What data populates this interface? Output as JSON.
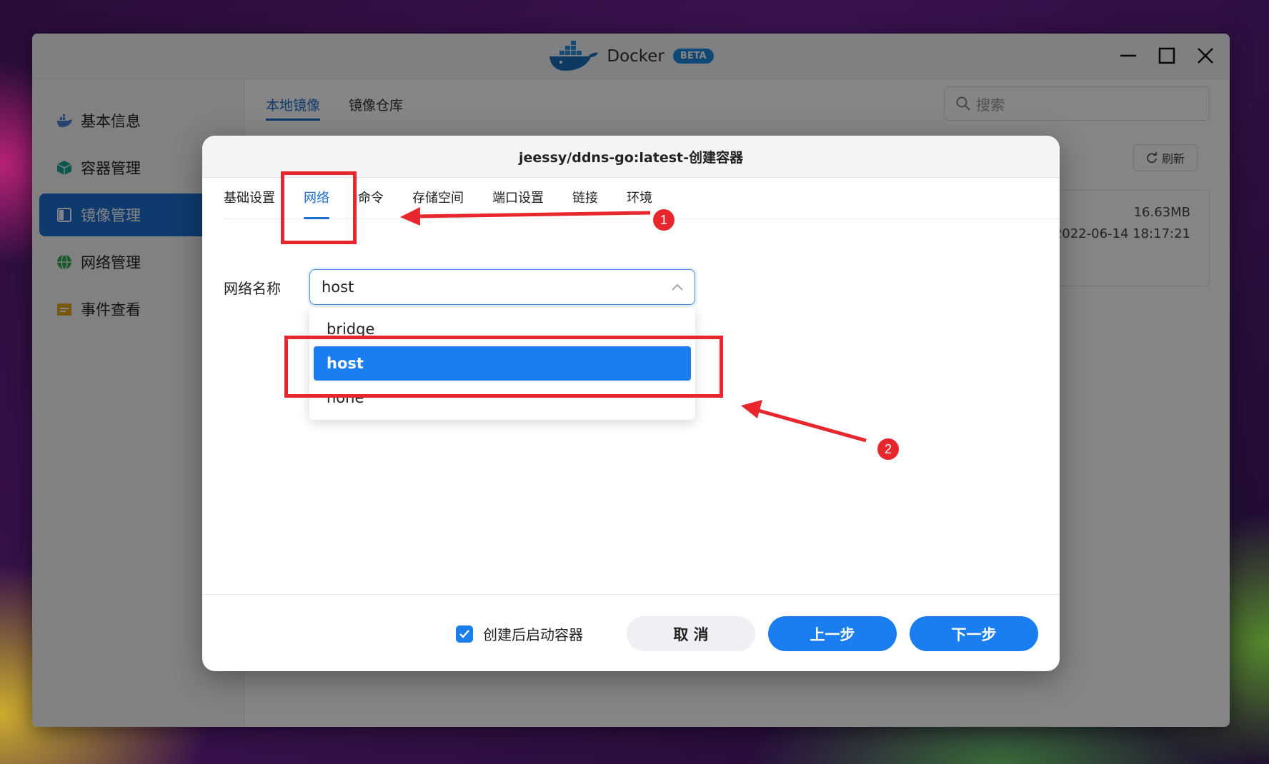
{
  "window": {
    "app_title": "Docker",
    "beta_badge": "BETA"
  },
  "sidebar": {
    "items": [
      {
        "label": "基本信息",
        "icon": "docker-whale-icon"
      },
      {
        "label": "容器管理",
        "icon": "cube-icon"
      },
      {
        "label": "镜像管理",
        "icon": "image-icon",
        "active": true
      },
      {
        "label": "网络管理",
        "icon": "globe-icon"
      },
      {
        "label": "事件查看",
        "icon": "event-log-icon"
      }
    ]
  },
  "main": {
    "tabs": [
      {
        "label": "本地镜像",
        "active": true
      },
      {
        "label": "镜像仓库"
      }
    ],
    "search_placeholder": "搜索",
    "refresh_label": "刷新",
    "image_card": {
      "size": "16.63MB",
      "date": "2022-06-14 18:17:21"
    }
  },
  "dialog": {
    "title": "jeessy/ddns-go:latest-创建容器",
    "tabs": [
      {
        "label": "基础设置"
      },
      {
        "label": "网络",
        "active": true
      },
      {
        "label": "命令"
      },
      {
        "label": "存储空间"
      },
      {
        "label": "端口设置"
      },
      {
        "label": "链接"
      },
      {
        "label": "环境"
      }
    ],
    "network_field": {
      "label": "网络名称",
      "value": "host",
      "options": [
        "bridge",
        "host",
        "none"
      ],
      "selected": "host"
    },
    "footer": {
      "start_after_create_label": "创建后启动容器",
      "start_after_create_checked": true,
      "cancel_label": "取 消",
      "prev_label": "上一步",
      "next_label": "下一步"
    }
  },
  "annotations": {
    "marker_1": "1",
    "marker_2": "2",
    "color": "#e8262d"
  },
  "colors": {
    "accent": "#1c6fd1",
    "primary_button": "#1b7ef0"
  }
}
